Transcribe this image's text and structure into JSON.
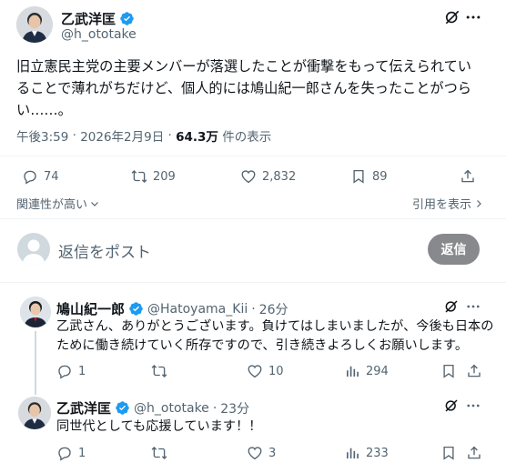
{
  "main_post": {
    "author_name": "乙武洋匡",
    "author_handle": "@h_ototake",
    "body_line1": "旧立憲民主党の主要メンバーが落選したことが衝撃をもって伝えられてい",
    "body_line2": "ることで薄れがちだけど、個人的には鳩山紀一郎さんを失ったことがつら",
    "body_line3": "い……。",
    "time": "午後3:59",
    "date": "2026年2月9日",
    "views_count": "64.3万",
    "views_suffix": "件の表示",
    "replies": "74",
    "reposts": "209",
    "likes": "2,832",
    "bookmarks": "89"
  },
  "sort": {
    "relevance_label": "関連性が高い",
    "quotes_label": "引用を表示"
  },
  "composer": {
    "placeholder": "返信をポスト",
    "reply_button": "返信"
  },
  "replies": [
    {
      "author_name": "鳩山紀一郎",
      "author_handle": "@Hatoyama_Kii",
      "time_ago": "26分",
      "body_line1": "乙武さん、ありがとうございます。負けてはしまいましたが、今後も日本の",
      "body_line2": "ために働き続けていく所存ですので、引き続きよろしくお願いします。",
      "replies": "1",
      "reposts": "",
      "likes": "10",
      "views": "294"
    },
    {
      "author_name": "乙武洋匡",
      "author_handle": "@h_ototake",
      "time_ago": "23分",
      "body_line1": "同世代としても応援しています！！",
      "replies": "1",
      "reposts": "",
      "likes": "3",
      "views": "233"
    }
  ],
  "colors": {
    "verified": "#1d9bf0",
    "text": "#0f1419",
    "secondary": "#536471",
    "reply_button_bg": "#87898c",
    "divider": "#eff3f4"
  },
  "icons": [
    "grok-icon",
    "more-icon",
    "reply-icon",
    "repost-icon",
    "like-icon",
    "bookmark-icon",
    "share-icon",
    "views-icon",
    "chevron-down-icon",
    "chevron-right-icon",
    "verified-badge-icon"
  ]
}
